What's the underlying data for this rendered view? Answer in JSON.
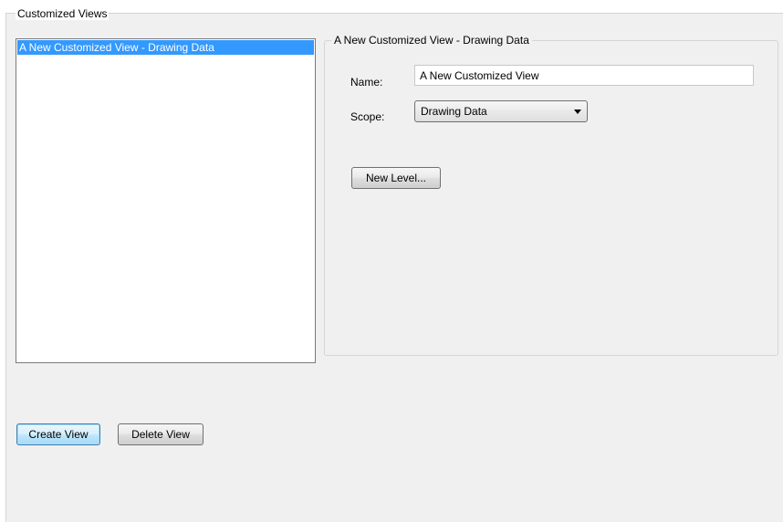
{
  "group": {
    "title": "Customized Views"
  },
  "views_list": {
    "items": [
      {
        "label": "A New Customized View - Drawing Data",
        "selected": true
      }
    ]
  },
  "details": {
    "title": "A New Customized View - Drawing Data",
    "name_label": "Name:",
    "name_value": "A New Customized View",
    "scope_label": "Scope:",
    "scope_value": "Drawing Data",
    "scope_icon": "dropdown-arrow-icon",
    "new_level_label": "New Level..."
  },
  "actions": {
    "create_label": "Create View",
    "delete_label": "Delete View"
  },
  "colors": {
    "selection": "#3399ff",
    "panel_background": "#f0f0f0",
    "default_button_border": "#3c7fb1"
  }
}
